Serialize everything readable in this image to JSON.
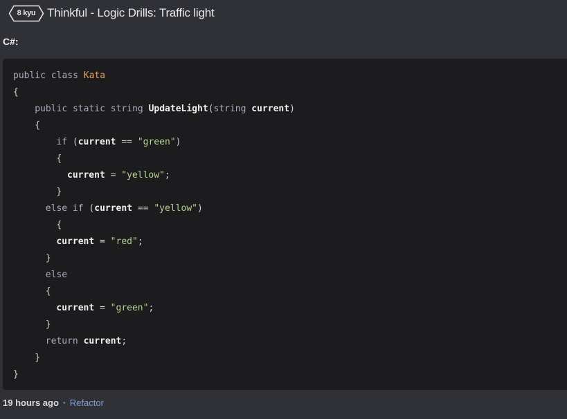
{
  "header": {
    "kyu_badge": "8 kyu",
    "title": "Thinkful - Logic Drills: Traffic light"
  },
  "language_label": "C#:",
  "code": {
    "lines": [
      {
        "indent": 0,
        "tokens": [
          {
            "t": "kw",
            "v": "public class "
          },
          {
            "t": "cls",
            "v": "Kata"
          }
        ]
      },
      {
        "indent": 0,
        "tokens": [
          {
            "t": "pl",
            "v": "{"
          }
        ]
      },
      {
        "indent": 4,
        "tokens": [
          {
            "t": "kw",
            "v": "public static string "
          },
          {
            "t": "ident",
            "v": "UpdateLight"
          },
          {
            "t": "pl",
            "v": "("
          },
          {
            "t": "kw",
            "v": "string "
          },
          {
            "t": "ident",
            "v": "current"
          },
          {
            "t": "pl",
            "v": ")"
          }
        ]
      },
      {
        "indent": 4,
        "tokens": [
          {
            "t": "pl",
            "v": "{"
          }
        ]
      },
      {
        "indent": 8,
        "tokens": [
          {
            "t": "kw",
            "v": "if "
          },
          {
            "t": "pl",
            "v": "("
          },
          {
            "t": "ident",
            "v": "current"
          },
          {
            "t": "pl",
            "v": " == "
          },
          {
            "t": "str",
            "v": "\"green\""
          },
          {
            "t": "pl",
            "v": ")"
          }
        ]
      },
      {
        "indent": 8,
        "tokens": [
          {
            "t": "pl",
            "v": "{"
          }
        ]
      },
      {
        "indent": 10,
        "tokens": [
          {
            "t": "ident",
            "v": "current"
          },
          {
            "t": "pl",
            "v": " = "
          },
          {
            "t": "str",
            "v": "\"yellow\""
          },
          {
            "t": "pl",
            "v": ";"
          }
        ]
      },
      {
        "indent": 8,
        "tokens": [
          {
            "t": "pl",
            "v": "}"
          }
        ]
      },
      {
        "indent": 6,
        "tokens": [
          {
            "t": "kw",
            "v": "else if "
          },
          {
            "t": "pl",
            "v": "("
          },
          {
            "t": "ident",
            "v": "current"
          },
          {
            "t": "pl",
            "v": " == "
          },
          {
            "t": "str",
            "v": "\"yellow\""
          },
          {
            "t": "pl",
            "v": ")"
          }
        ]
      },
      {
        "indent": 8,
        "tokens": [
          {
            "t": "pl",
            "v": "{"
          }
        ]
      },
      {
        "indent": 8,
        "tokens": [
          {
            "t": "ident",
            "v": "current"
          },
          {
            "t": "pl",
            "v": " = "
          },
          {
            "t": "str",
            "v": "\"red\""
          },
          {
            "t": "pl",
            "v": ";"
          }
        ]
      },
      {
        "indent": 6,
        "tokens": [
          {
            "t": "pl",
            "v": "}"
          }
        ]
      },
      {
        "indent": 6,
        "tokens": [
          {
            "t": "kw",
            "v": "else"
          }
        ]
      },
      {
        "indent": 6,
        "tokens": [
          {
            "t": "pl",
            "v": "{"
          }
        ]
      },
      {
        "indent": 8,
        "tokens": [
          {
            "t": "ident",
            "v": "current"
          },
          {
            "t": "pl",
            "v": " = "
          },
          {
            "t": "str",
            "v": "\"green\""
          },
          {
            "t": "pl",
            "v": ";"
          }
        ]
      },
      {
        "indent": 6,
        "tokens": [
          {
            "t": "pl",
            "v": "}"
          }
        ]
      },
      {
        "indent": 6,
        "tokens": [
          {
            "t": "kw",
            "v": "return "
          },
          {
            "t": "ident",
            "v": "current"
          },
          {
            "t": "pl",
            "v": ";"
          }
        ]
      },
      {
        "indent": 4,
        "tokens": [
          {
            "t": "pl",
            "v": "}"
          }
        ]
      },
      {
        "indent": 0,
        "tokens": [
          {
            "t": "pl",
            "v": "}"
          }
        ]
      }
    ]
  },
  "footer": {
    "timestamp": "19 hours ago",
    "separator": "•",
    "refactor_label": "Refactor"
  },
  "colors": {
    "background": "#303136",
    "code_background": "#1c1c1e",
    "keyword": "#b2a6bd",
    "class_name": "#e8a05b",
    "string": "#b8d28f",
    "link": "#7f9ed1"
  }
}
